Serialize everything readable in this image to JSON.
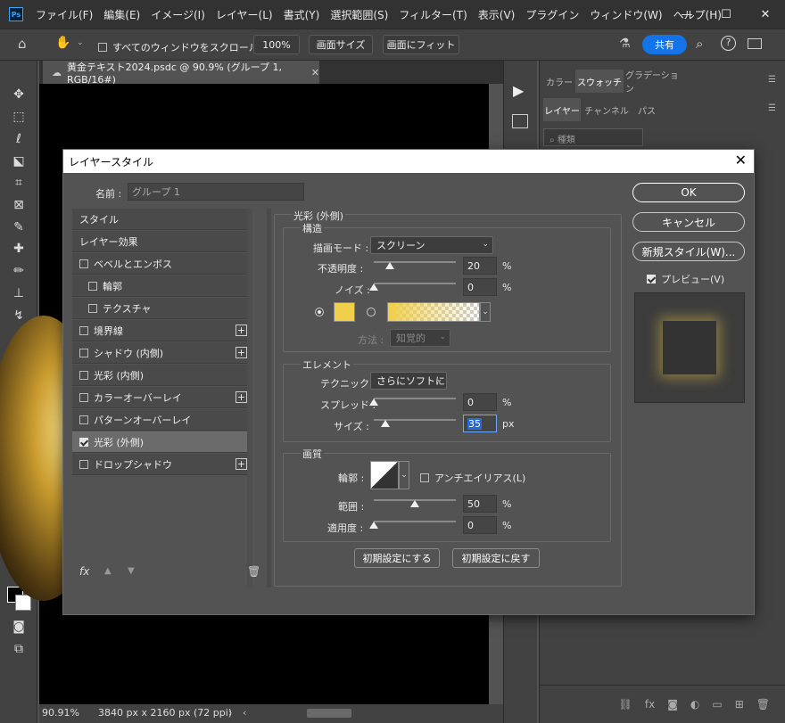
{
  "app": {
    "logo": "Ps",
    "menu": [
      "ファイル(F)",
      "編集(E)",
      "イメージ(I)",
      "レイヤー(L)",
      "書式(Y)",
      "選択範囲(S)",
      "フィルター(T)",
      "表示(V)",
      "プラグイン",
      "ウィンドウ(W)",
      "ヘルプ(H)"
    ],
    "window_controls": [
      "—",
      "☐",
      "✕"
    ]
  },
  "options_bar": {
    "scroll_all_label": "すべてのウィンドウをスクロール",
    "zoom_100": "100%",
    "fit_screen": "画面サイズ",
    "fill_screen": "画面にフィット",
    "share": "共有"
  },
  "document": {
    "tab_title": "黄金テキスト2024.psdc @ 90.9% (グループ 1, RGB/16#)",
    "zoom": "90.91%",
    "dimensions": "3840 px x 2160 px (72 ppi)"
  },
  "panels": {
    "top_tabs": [
      "カラー",
      "スウォッチ",
      "グラデーション"
    ],
    "layer_tabs": [
      "レイヤー",
      "チャンネル",
      "パス"
    ],
    "filter_placeholder": "種類"
  },
  "dialog": {
    "title": "レイヤースタイル",
    "name_label": "名前 :",
    "name_value": "グループ 1",
    "styles": [
      {
        "label": "スタイル",
        "type": "header"
      },
      {
        "label": "レイヤー効果",
        "type": "header"
      },
      {
        "label": "ベベルとエンボス",
        "type": "check",
        "checked": false,
        "plus": false
      },
      {
        "label": "輪郭",
        "type": "sub",
        "checked": false,
        "plus": false
      },
      {
        "label": "テクスチャ",
        "type": "sub",
        "checked": false,
        "plus": false
      },
      {
        "label": "境界線",
        "type": "check",
        "checked": false,
        "plus": true
      },
      {
        "label": "シャドウ (内側)",
        "type": "check",
        "checked": false,
        "plus": true
      },
      {
        "label": "光彩 (内側)",
        "type": "check",
        "checked": false,
        "plus": false
      },
      {
        "label": "カラーオーバーレイ",
        "type": "check",
        "checked": false,
        "plus": true
      },
      {
        "label": "パターンオーバーレイ",
        "type": "check",
        "checked": false,
        "plus": false
      },
      {
        "label": "光彩 (外側)",
        "type": "check",
        "checked": true,
        "plus": false,
        "selected": true
      },
      {
        "label": "ドロップシャドウ",
        "type": "check",
        "checked": false,
        "plus": true
      }
    ],
    "section_title": "光彩 (外側)",
    "structure": {
      "title": "構造",
      "blend_label": "描画モード :",
      "blend_value": "スクリーン",
      "opacity_label": "不透明度 :",
      "opacity_value": "20",
      "noise_label": "ノイズ :",
      "noise_value": "0",
      "unit_pct": "%",
      "glow_color": "#f0cf4a",
      "method_label": "方法 :",
      "method_value": "知覚的"
    },
    "elements": {
      "title": "エレメント",
      "technique_label": "テクニック :",
      "technique_value": "さらにソフトに",
      "spread_label": "スプレッド :",
      "spread_value": "0",
      "size_label": "サイズ :",
      "size_value": "35",
      "unit_px": "px"
    },
    "quality": {
      "title": "画質",
      "contour_label": "輪郭 :",
      "antialias_label": "アンチエイリアス(L)",
      "range_label": "範囲 :",
      "range_value": "50",
      "jitter_label": "適用度 :",
      "jitter_value": "0"
    },
    "make_default": "初期設定にする",
    "reset_default": "初期設定に戻す",
    "ok": "OK",
    "cancel": "キャンセル",
    "new_style": "新規スタイル(W)...",
    "preview_label": "プレビュー(V)",
    "fx_label": "fx"
  },
  "slider_levels": {
    "opacity": 0.2,
    "noise": 0.0,
    "spread": 0.0,
    "size": 0.14,
    "range": 0.5,
    "jitter": 0.0
  }
}
